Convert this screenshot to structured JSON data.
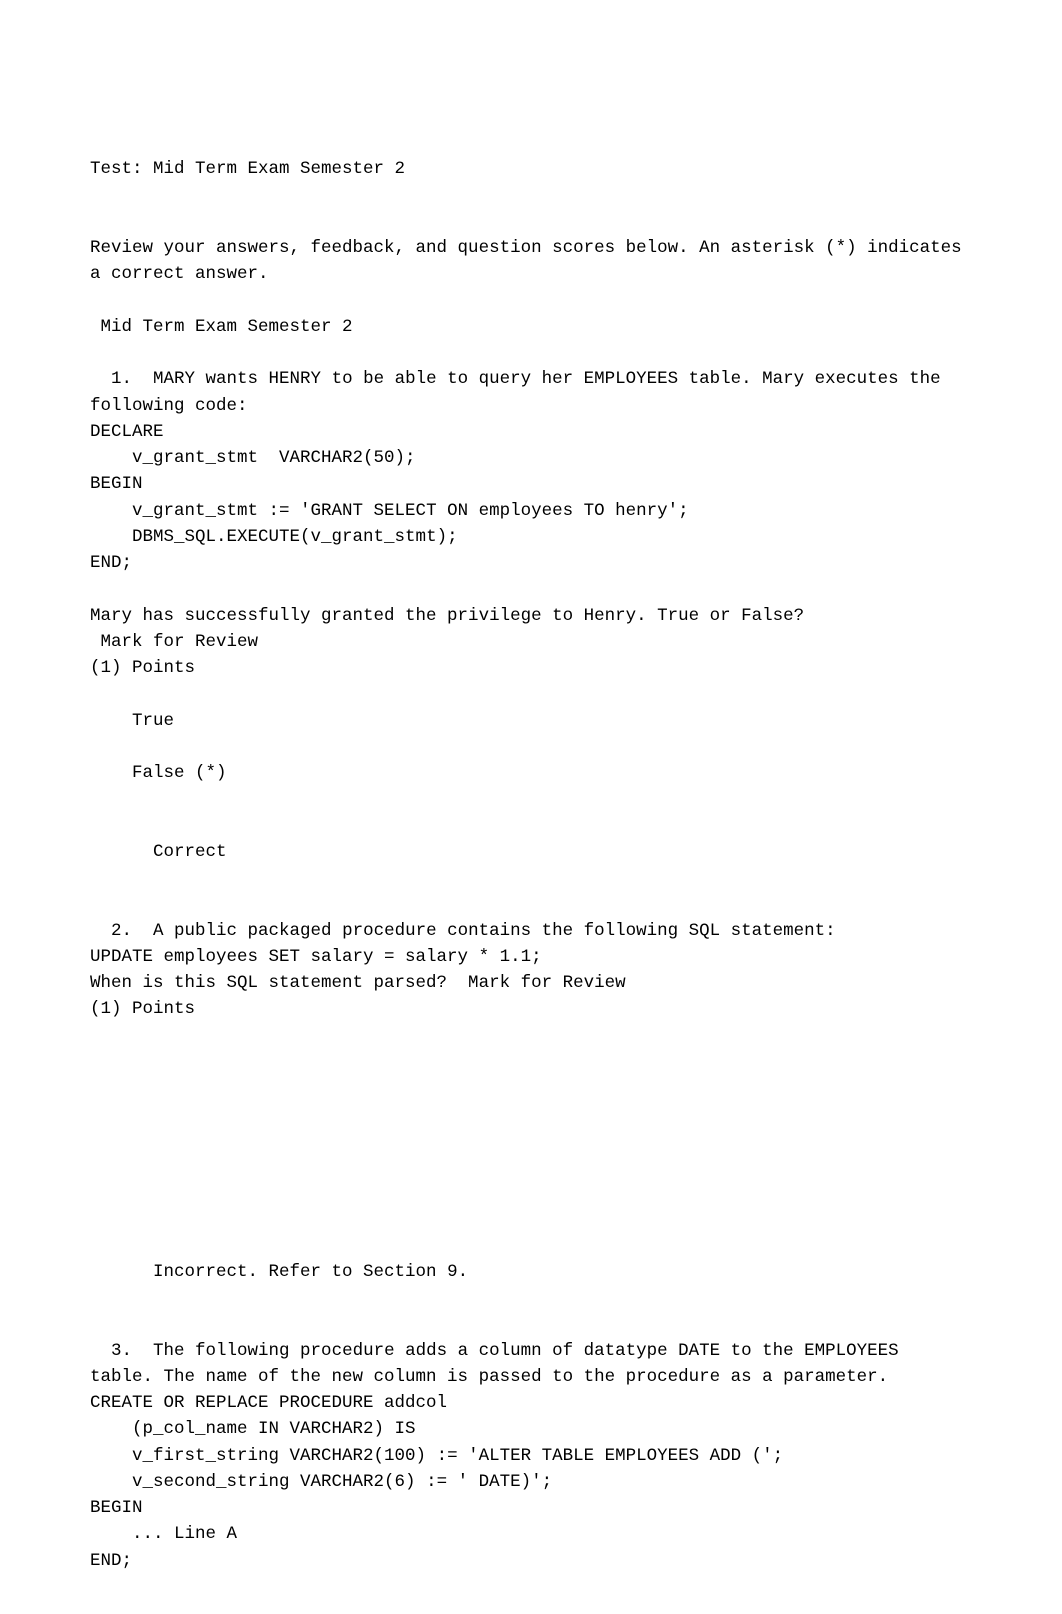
{
  "header": {
    "test_title": "Test: Mid Term Exam Semester 2"
  },
  "intro": {
    "review_text": "Review your answers, feedback, and question scores below. An asterisk (*) indicates a correct answer.",
    "section_heading": " Mid Term Exam Semester 2"
  },
  "q1": {
    "number": "  1.",
    "stem": "  MARY wants HENRY to be able to query her EMPLOYEES table. Mary executes the following code:",
    "code_l1": "DECLARE",
    "code_l2": "    v_grant_stmt  VARCHAR2(50);",
    "code_l3": "BEGIN",
    "code_l4": "    v_grant_stmt := 'GRANT SELECT ON employees TO henry';",
    "code_l5": "    DBMS_SQL.EXECUTE(v_grant_stmt);",
    "code_l6": "END;",
    "after_code": "Mary has successfully granted the privilege to Henry. True or False?",
    "mark": " Mark for Review",
    "points": "(1) Points",
    "opt_true": "    True",
    "opt_false": "    False (*)",
    "feedback": "      Correct"
  },
  "q2": {
    "number": "  2.",
    "stem": "  A public packaged procedure contains the following SQL statement:",
    "code_l1": "UPDATE employees SET salary = salary * 1.1;",
    "stem2": "When is this SQL statement parsed?  Mark for Review",
    "points": "(1) Points",
    "feedback": "      Incorrect. Refer to Section 9."
  },
  "q3": {
    "number": "  3.",
    "stem": "  The following procedure adds a column of datatype DATE to the EMPLOYEES table. The name of the new column is passed to the procedure as a parameter.",
    "code_l1": "CREATE OR REPLACE PROCEDURE addcol",
    "code_l2": "    (p_col_name IN VARCHAR2) IS",
    "code_l3": "    v_first_string VARCHAR2(100) := 'ALTER TABLE EMPLOYEES ADD (';",
    "code_l4": "    v_second_string VARCHAR2(6) := ' DATE)';",
    "code_l5": "BEGIN",
    "code_l6": "    ... Line A",
    "code_l7": "END;"
  }
}
